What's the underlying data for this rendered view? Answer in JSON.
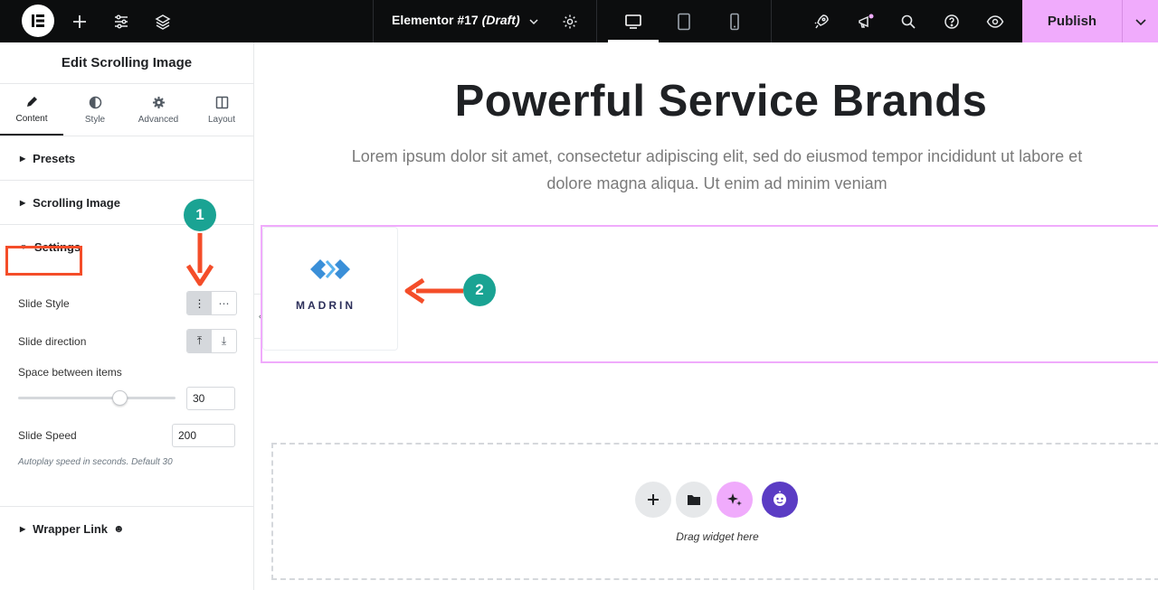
{
  "topbar": {
    "doc_name": "Elementor #17",
    "doc_status": "(Draft)",
    "publish_label": "Publish"
  },
  "panel": {
    "title": "Edit Scrolling Image",
    "tabs": [
      {
        "label": "Content",
        "icon": "pencil-icon"
      },
      {
        "label": "Style",
        "icon": "half-circle-icon"
      },
      {
        "label": "Advanced",
        "icon": "gear-icon"
      },
      {
        "label": "Layout",
        "icon": "columns-icon"
      }
    ],
    "sections": {
      "presets": "Presets",
      "scrolling_image": "Scrolling Image",
      "settings": "Settings",
      "wrapper_link": "Wrapper Link"
    },
    "controls": {
      "slide_style_label": "Slide Style",
      "slide_direction_label": "Slide direction",
      "space_label": "Space between items",
      "space_value": "30",
      "space_slider_level": 0.65,
      "slide_speed_label": "Slide Speed",
      "slide_speed_value": "200",
      "help_text": "Autoplay speed in seconds. Default 30"
    }
  },
  "canvas": {
    "heading": "Powerful Service Brands",
    "paragraph": "Lorem ipsum dolor sit amet, consectetur adipiscing elit, sed do eiusmod tempor incididunt ut labore et dolore magna aliqua. Ut enim ad minim veniam",
    "logo_text": "MADRIN",
    "drag_label": "Drag widget here"
  },
  "annotations": {
    "badge1": "1",
    "badge2": "2"
  },
  "colors": {
    "accent_pink": "#f0abfc",
    "annotation_orange": "#f44d29",
    "badge_teal": "#1aa393",
    "ai_purple": "#5b3cc4"
  }
}
